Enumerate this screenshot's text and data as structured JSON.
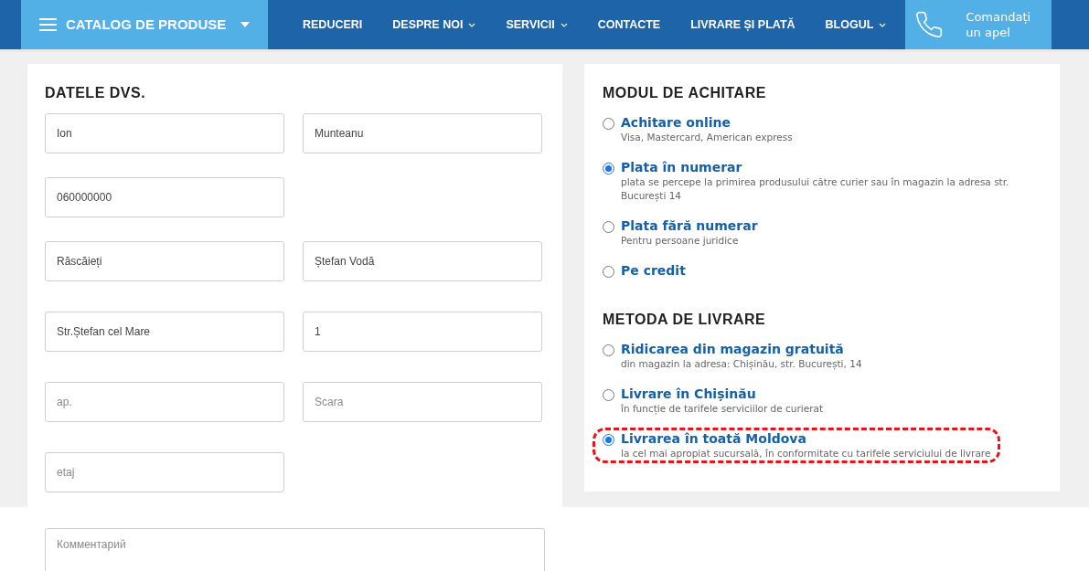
{
  "nav": {
    "catalog": "CATALOG DE PRODUSE",
    "items": [
      {
        "label": "REDUCERI",
        "dropdown": false
      },
      {
        "label": "DESPRE NOI",
        "dropdown": true
      },
      {
        "label": "SERVICII",
        "dropdown": true
      },
      {
        "label": "CONTACTE",
        "dropdown": false
      },
      {
        "label": "LIVRARE ȘI PLATĂ",
        "dropdown": false
      },
      {
        "label": "BLOGUL",
        "dropdown": true
      }
    ],
    "callback": "Comandați un apel"
  },
  "personal": {
    "title": "DATELE DVS.",
    "rows": [
      [
        {
          "value": "Ion"
        },
        {
          "value": "Munteanu"
        }
      ],
      [
        {
          "value": "060000000"
        }
      ],
      [
        {
          "value": "Răscăieți"
        },
        {
          "value": "Ștefan Vodă"
        }
      ],
      [
        {
          "value": "Str.Ștefan cel Mare"
        },
        {
          "value": "1"
        }
      ],
      [
        {
          "placeholder": "ap."
        },
        {
          "placeholder": "Scara"
        }
      ],
      [
        {
          "placeholder": "etaj"
        }
      ]
    ],
    "comment": {
      "placeholder": "Комментарий"
    }
  },
  "payment": {
    "title": "MODUL DE ACHITARE",
    "options": [
      {
        "label": "Achitare online",
        "description": "Visa, Mastercard, American express",
        "selected": false,
        "highlighted": false
      },
      {
        "label": "Plata în numerar",
        "description": "plata se percepe la primirea produsului către curier sau în magazin la adresa str. București 14",
        "selected": true,
        "highlighted": false
      },
      {
        "label": "Plata fără numerar",
        "description": "Pentru persoane juridice",
        "selected": false,
        "highlighted": false
      },
      {
        "label": "Pe credit",
        "selected": false,
        "highlighted": false
      }
    ]
  },
  "delivery": {
    "title": "METODA DE LIVRARE",
    "options": [
      {
        "label": "Ridicarea din magazin gratuită",
        "description": "din magazin la adresa: Chișinău, str. București, 14",
        "selected": false,
        "highlighted": false
      },
      {
        "label": "Livrare în Chișinău",
        "description": "în funcție de tarifele serviciilor de curierat",
        "selected": false,
        "highlighted": false
      },
      {
        "label": "Livrarea în toată Moldova",
        "description": "la cel mai apropiat sucursală, în conformitate cu tarifele serviciului de livrare",
        "selected": true,
        "highlighted": true
      }
    ]
  }
}
